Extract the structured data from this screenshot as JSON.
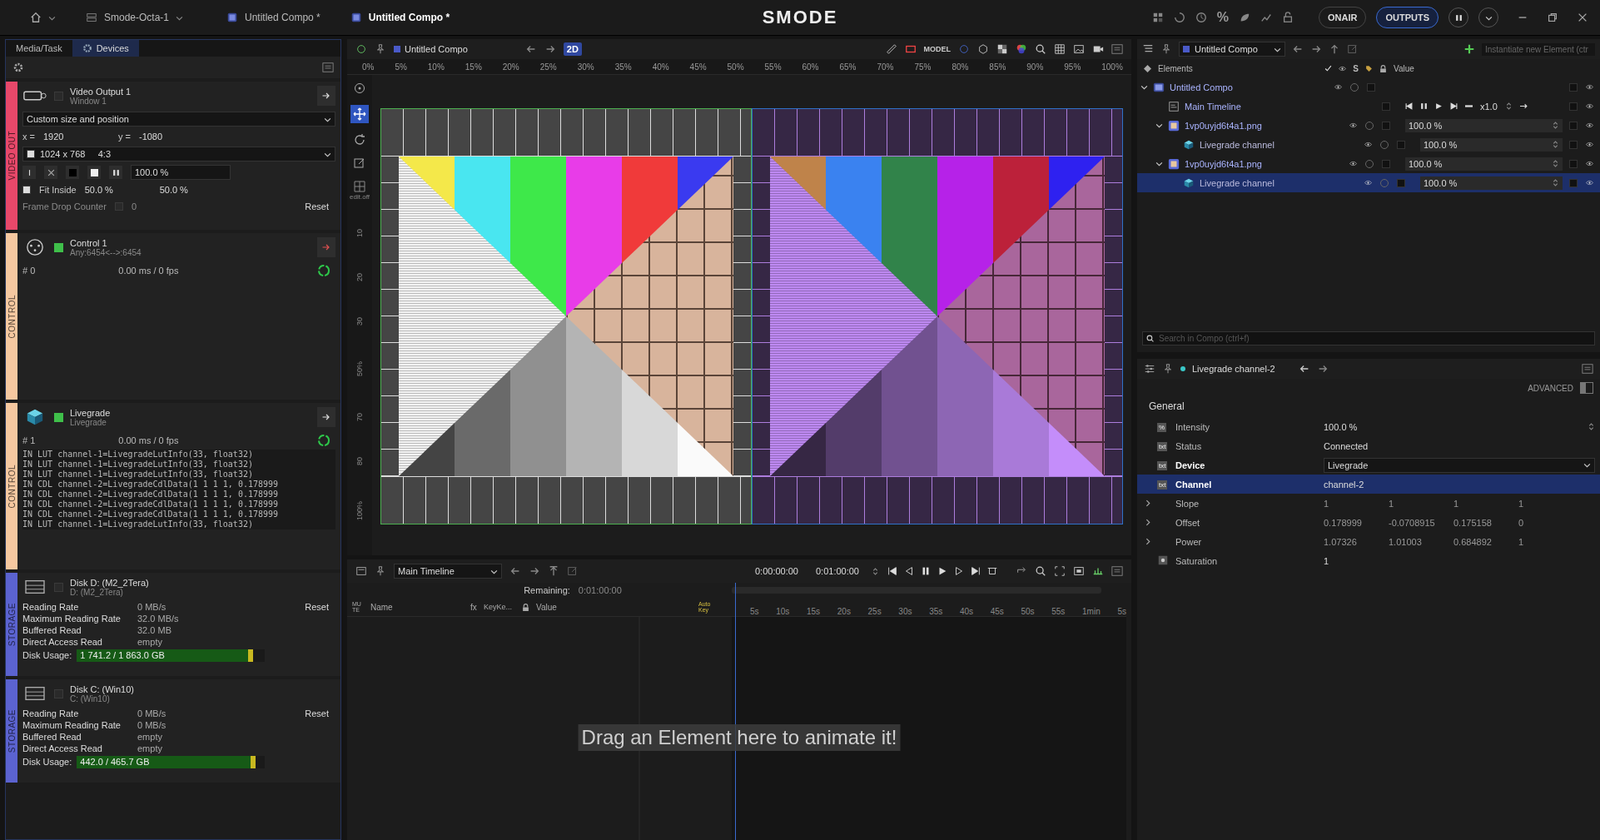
{
  "topbar": {
    "project": "Smode-Octa-1",
    "tabs": [
      {
        "label": "Untitled Compo *",
        "selected": false
      },
      {
        "label": "Untitled Compo *",
        "selected": true
      }
    ],
    "logo": "SMODE",
    "percent": "%",
    "onair": "ONAIR",
    "outputs": "OUTPUTS"
  },
  "left": {
    "tabs": [
      {
        "label": "Media/Task",
        "selected": false
      },
      {
        "label": "Devices",
        "selected": true
      }
    ],
    "devices": [
      {
        "kind": "video",
        "category": "VIDEO OUT",
        "color": "#e8486a",
        "name": "Video Output 1",
        "sub": "Window 1",
        "enabled": false,
        "mode": "Custom size and position",
        "x_label": "x =",
        "x": "1920",
        "y_label": "y =",
        "y": "-1080",
        "size": "1024 x 768",
        "ratio": "4:3",
        "intensity": "100.0 %",
        "fit": "Fit Inside",
        "fit_x": "50.0 %",
        "fit_y": "50.0 %",
        "frame_drop": "Frame Drop Counter",
        "frame_drop_value": "0",
        "reset": "Reset"
      },
      {
        "kind": "control",
        "category": "CONTROL",
        "color": "#f6c8a0",
        "name": "Control 1",
        "sub": "Any:6454<-->:6454",
        "enabled": true,
        "count": "# 0",
        "stats": "0.00 ms / 0 fps",
        "log": []
      },
      {
        "kind": "control",
        "category": "CONTROL",
        "color": "#f6c8a0",
        "name": "Livegrade",
        "sub": "Livegrade",
        "enabled": true,
        "count": "# 1",
        "stats": "0.00 ms / 0 fps",
        "log": [
          "IN LUT channel-1=LivegradeLutInfo(33, float32)",
          "IN LUT channel-1=LivegradeLutInfo(33, float32)",
          "IN LUT channel-1=LivegradeLutInfo(33, float32)",
          "IN CDL channel-2=LivegradeCdlData(1 1 1 1, 0.178999",
          "IN CDL channel-2=LivegradeCdlData(1 1 1 1, 0.178999",
          "IN CDL channel-2=LivegradeCdlData(1 1 1 1, 0.178999",
          "IN CDL channel-2=LivegradeCdlData(1 1 1 1, 0.178999",
          "IN LUT channel-1=LivegradeLutInfo(33, float32)"
        ]
      },
      {
        "kind": "storage",
        "category": "STORAGE",
        "color": "#5b63d0",
        "name": "Disk D: (M2_2Tera)",
        "sub": "D: (M2_2Tera)",
        "enabled": false,
        "reset": "Reset",
        "rows": [
          {
            "label": "Reading Rate",
            "value": "0 MB/s"
          },
          {
            "label": "Maximum Reading Rate",
            "value": "32.0 MB/s"
          },
          {
            "label": "Buffered Read",
            "value": "32.0 MB"
          },
          {
            "label": "Direct Access Read",
            "value": "empty"
          }
        ],
        "usage_label": "Disk Usage:",
        "usage": "1 741.2 / 1 863.0 GB",
        "level": 0.935
      },
      {
        "kind": "storage",
        "category": "STORAGE",
        "color": "#5b63d0",
        "name": "Disk C: (Win10)",
        "sub": "C: (Win10)",
        "enabled": false,
        "reset": "Reset",
        "rows": [
          {
            "label": "Reading Rate",
            "value": "0 MB/s"
          },
          {
            "label": "Maximum Reading Rate",
            "value": "0 MB/s"
          },
          {
            "label": "Buffered Read",
            "value": "empty"
          },
          {
            "label": "Direct Access Read",
            "value": "empty"
          }
        ],
        "usage_label": "Disk Usage:",
        "usage": "442.0 / 465.7 GB",
        "level": 0.95
      }
    ]
  },
  "viewport": {
    "compo": "Untitled Compo",
    "mode": "2D",
    "model": "MODEL",
    "ruler": [
      "0%",
      "5%",
      "10%",
      "15%",
      "20%",
      "25%",
      "30%",
      "35%",
      "40%",
      "45%",
      "50%",
      "55%",
      "60%",
      "65%",
      "70%",
      "75%",
      "80%",
      "85%",
      "90%",
      "95%",
      "100%"
    ],
    "vruler": [
      "10",
      "20",
      "30",
      "50%",
      "70",
      "80",
      "100%"
    ],
    "edit": "edit.off",
    "images": [
      {
        "tint": "#ffffff",
        "outline": "#4caf50"
      },
      {
        "tint": "#c890ff",
        "outline": "#3cc8c8"
      }
    ]
  },
  "timeline": {
    "name": "Main Timeline",
    "start": "0:00:00:00",
    "end": "0:01:00:00",
    "remaining_label": "Remaining:",
    "remaining": "0:01:00:00",
    "mute": "MUTE",
    "columns": [
      "Name",
      "fx",
      "KeyKe...",
      "Value"
    ],
    "auto_key": "Auto Key",
    "ticks": [
      "5s",
      "10s",
      "15s",
      "20s",
      "25s",
      "30s",
      "35s",
      "40s",
      "45s",
      "50s",
      "55s",
      "1min",
      "5s"
    ],
    "hint": "Drag an Element here to animate it!"
  },
  "tree": {
    "compo": "Untitled Compo",
    "instantiate_placeholder": "Instantiate new Element (ctr",
    "columns": {
      "elements": "Elements",
      "s": "S",
      "value": "Value"
    },
    "rows": [
      {
        "label": "Untitled Compo",
        "depth": 0,
        "kind": "compo",
        "expanded": true,
        "selected": false,
        "value": ""
      },
      {
        "label": "Main Timeline",
        "depth": 1,
        "kind": "timeline",
        "expanded": false,
        "selected": false,
        "value": "x1.0"
      },
      {
        "label": "1vp0uyjd6t4a1.png",
        "depth": 1,
        "kind": "image",
        "expanded": true,
        "selected": false,
        "value": "100.0 %"
      },
      {
        "label": "Livegrade channel",
        "depth": 2,
        "kind": "channel",
        "expanded": false,
        "selected": false,
        "value": "100.0 %"
      },
      {
        "label": "1vp0uyjd6t4a1.png",
        "depth": 1,
        "kind": "image",
        "expanded": true,
        "selected": false,
        "value": "100.0 %"
      },
      {
        "label": "Livegrade channel",
        "depth": 2,
        "kind": "channel",
        "expanded": false,
        "selected": true,
        "value": "100.0 %"
      }
    ],
    "search_placeholder": "Search in Compo (ctrl+f)"
  },
  "inspector": {
    "title": "Livegrade channel-2",
    "advanced": "ADVANCED",
    "advanced_on": false,
    "section": "General",
    "props": [
      {
        "label": "Intensity",
        "kind": "percent",
        "badge": "%",
        "value": "100.0 %",
        "bold": false,
        "selected": false
      },
      {
        "label": "Status",
        "kind": "text",
        "badge": "txt",
        "value": "Connected",
        "bold": false,
        "selected": false
      },
      {
        "label": "Device",
        "kind": "dropdown",
        "badge": "txt",
        "value": "Livegrade",
        "bold": true,
        "selected": false
      },
      {
        "label": "Channel",
        "kind": "text",
        "badge": "txt",
        "value": "channel-2",
        "bold": true,
        "selected": true
      },
      {
        "label": "Slope",
        "kind": "vector",
        "badge": "",
        "values": [
          "1",
          "1",
          "1",
          "1"
        ],
        "bold": false,
        "selected": false
      },
      {
        "label": "Offset",
        "kind": "vector",
        "badge": "",
        "values": [
          "0.178999",
          "-0.0708915",
          "0.175158",
          "0"
        ],
        "bold": false,
        "selected": false
      },
      {
        "label": "Power",
        "kind": "vector",
        "badge": "",
        "values": [
          "1.07326",
          "1.01003",
          "0.684892",
          "1"
        ],
        "bold": false,
        "selected": false
      },
      {
        "label": "Saturation",
        "kind": "number",
        "badge": "",
        "value": "1",
        "bold": false,
        "selected": false
      }
    ]
  }
}
